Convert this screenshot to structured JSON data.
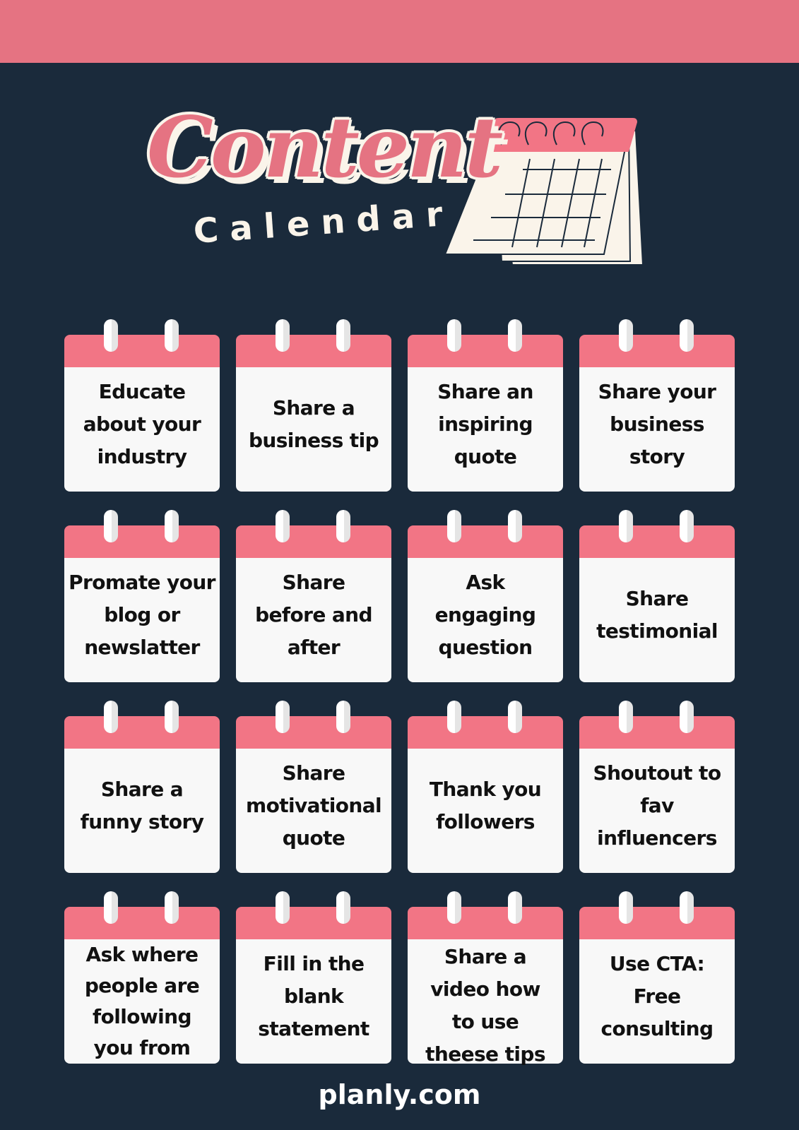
{
  "header": {
    "title_main": "Content",
    "title_sub": "Calendar",
    "illustration": "calendar-icon"
  },
  "colors": {
    "top_bar": "#E57382",
    "background": "#1A2A3B",
    "card_header": "#F27585",
    "card_body": "#F8F8F8",
    "title_pink": "#E57382",
    "cream": "#FAF4EA"
  },
  "cards": [
    {
      "text": "Educate\nabout your\nindustry"
    },
    {
      "text": "Share a\nbusiness tip\n "
    },
    {
      "text": "Share an\ninspiring\nquote"
    },
    {
      "text": "Share your\nbusiness\nstory"
    },
    {
      "text": "Promate your\nblog or\nnewslatter"
    },
    {
      "text": "Share\nbefore and\nafter"
    },
    {
      "text": "Ask\nengaging\nquestion"
    },
    {
      "text": "Share\ntestimonial\n "
    },
    {
      "text": "Share a\nfunny story\n "
    },
    {
      "text": "Share\nmotivational\nquote"
    },
    {
      "text": "Thank you\nfollowers\n "
    },
    {
      "text": "Shoutout to\nfav\ninfluencers"
    },
    {
      "text": "Ask where\npeople are\nfollowing\nyou from"
    },
    {
      "text": "Fill in the\nblank\nstatement"
    },
    {
      "text": "Share a\nvideo how\nto use\ntheese tips"
    },
    {
      "text": "Use CTA:\nFree\nconsulting"
    }
  ],
  "footer": {
    "site": "planly.com"
  }
}
